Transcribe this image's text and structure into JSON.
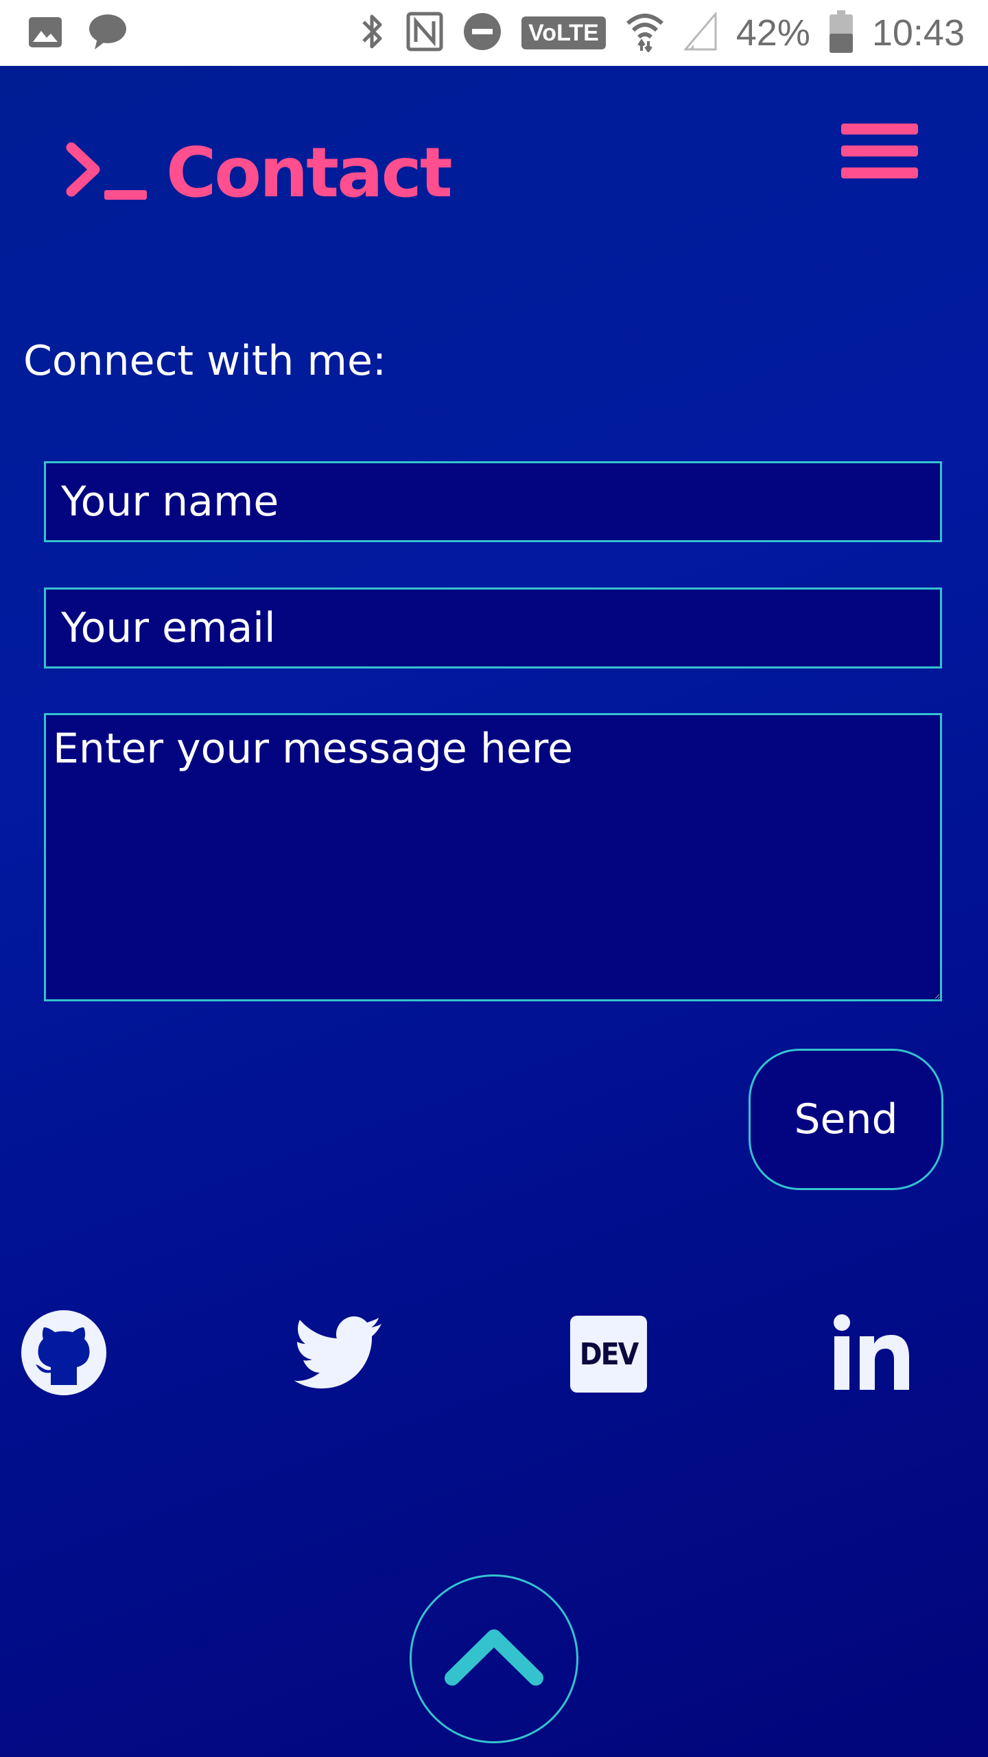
{
  "status_bar": {
    "battery": "42%",
    "time": "10:43",
    "network_badge": "VoLTE",
    "icons": [
      "image-icon",
      "chat-bubble-icon",
      "bluetooth-icon",
      "nfc-icon",
      "do-not-disturb-icon",
      "volte-icon",
      "wifi-icon",
      "signal-icon",
      "battery-icon"
    ]
  },
  "header": {
    "logo_icon": "terminal-prompt-icon",
    "title": "Contact",
    "menu_icon": "hamburger-menu-icon"
  },
  "form": {
    "intro": "Connect with me:",
    "name_placeholder": "Your name",
    "email_placeholder": "Your email",
    "message_placeholder": "Enter your message here",
    "send_label": "Send"
  },
  "social": [
    {
      "name": "GitHub",
      "icon": "github-icon"
    },
    {
      "name": "Twitter",
      "icon": "twitter-icon"
    },
    {
      "name": "DEV",
      "icon": "dev-icon",
      "badge_text": "DEV"
    },
    {
      "name": "LinkedIn",
      "icon": "linkedin-icon"
    }
  ],
  "scroll_top": {
    "icon": "chevron-up-icon"
  },
  "colors": {
    "accent_pink": "#ff4f8e",
    "accent_teal": "#35c2cf",
    "background_blue": "#011aa0",
    "field_background": "#030580",
    "text": "#ffffff"
  }
}
